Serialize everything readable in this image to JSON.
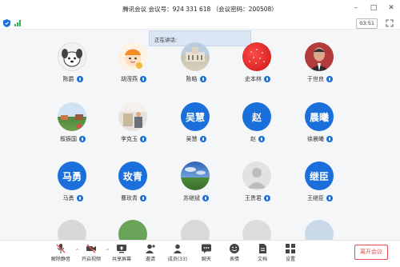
{
  "window": {
    "title": "腾讯会议  会议号：924 331 618  （会议密码：200508）",
    "controls": [
      "–",
      "□",
      "✕"
    ]
  },
  "status": {
    "timer": "03:51"
  },
  "speaking_banner": "正在讲话:",
  "participants": [
    {
      "name": "陈爵",
      "avatar_type": "cartoon-dog"
    },
    {
      "name": "胡滢燕",
      "avatar_type": "cartoon-child"
    },
    {
      "name": "陈皓",
      "avatar_type": "building-photo"
    },
    {
      "name": "史本林",
      "avatar_type": "strawberry-photo"
    },
    {
      "name": "于世良",
      "avatar_type": "portrait-photo"
    },
    {
      "name": "叙振国",
      "avatar_type": "landscape-photo"
    },
    {
      "name": "李克玉",
      "avatar_type": "room-photo"
    },
    {
      "name": "吴慧",
      "avatar_type": "text",
      "avatar_text": "吴慧"
    },
    {
      "name": "赵",
      "avatar_type": "text",
      "avatar_text": "赵"
    },
    {
      "name": "徐晨曦",
      "avatar_type": "text",
      "avatar_text": "晨曦"
    },
    {
      "name": "马勇",
      "avatar_type": "text",
      "avatar_text": "马勇"
    },
    {
      "name": "曹玫青",
      "avatar_type": "text",
      "avatar_text": "玫青"
    },
    {
      "name": "苏继斌",
      "avatar_type": "sky-photo"
    },
    {
      "name": "王贵君",
      "avatar_type": "default-gray"
    },
    {
      "name": "王继臣",
      "avatar_type": "text",
      "avatar_text": "继臣"
    }
  ],
  "toolbar": {
    "unmute": "解除静音",
    "video": "开启视频",
    "share": "共享屏幕",
    "invite": "邀请",
    "members": "成员(33)",
    "chat": "聊天",
    "reactions": "表情",
    "docs": "文档",
    "settings": "设置",
    "leave": "离开会议"
  },
  "colors": {
    "accent": "#1a6fdb",
    "leave": "#e34d4d",
    "mute": "#e34d4d"
  }
}
